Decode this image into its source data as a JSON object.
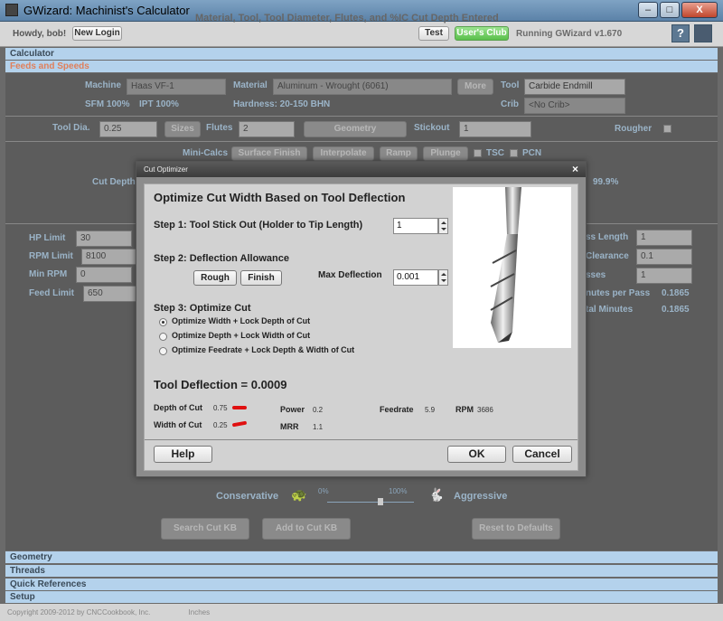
{
  "window": {
    "title": "GWizard: Machinist's Calculator",
    "buttons": [
      "–",
      "□",
      "X"
    ]
  },
  "topbar": {
    "greeting": "Howdy, bob!",
    "new_login": "New Login",
    "test": "Test",
    "users_club": "User's Club",
    "status": "Running GWizard v1.670",
    "help": "?"
  },
  "sections": {
    "calculator": "Calculator",
    "feeds_speeds": "Feeds and Speeds",
    "geometry": "Geometry",
    "threads": "Threads",
    "quick_references": "Quick References",
    "setup": "Setup"
  },
  "bg_title": "Material, Tool, Tool Diameter, Flutes, and %IC Cut Depth Entered",
  "feeds": {
    "machine_label": "Machine",
    "machine_value": "Haas VF-1",
    "material_label": "Material",
    "material_value": "Aluminum - Wrought (6061)",
    "more": "More",
    "tool_label": "Tool",
    "tool_value": "Carbide Endmill",
    "sfm": "SFM 100%",
    "ipt": "IPT 100%",
    "hardness": "Hardness: 20-150 BHN",
    "crib_label": "Crib",
    "crib_value": "<No Crib>",
    "tooldia_label": "Tool Dia.",
    "tooldia_value": "0.25",
    "sizes": "Sizes",
    "flutes_label": "Flutes",
    "flutes_value": "2",
    "geometry_btn": "Geometry",
    "stickout_label": "Stickout",
    "stickout_value": "1",
    "rougher_label": "Rougher",
    "minicalcs": "Mini-Calcs",
    "surface_finish": "Surface Finish",
    "interpolate": "Interpolate",
    "ramp": "Ramp",
    "plunge": "Plunge",
    "tsc": "TSC",
    "pcn": "PCN",
    "cut_depth": "Cut Depth",
    "pct": "99.9%",
    "hp_limit_label": "HP Limit",
    "hp_limit": "30",
    "rpm_limit_label": "RPM Limit",
    "rpm_limit": "8100",
    "min_rpm_label": "Min RPM",
    "min_rpm": "0",
    "feed_limit_label": "Feed Limit",
    "feed_limit": "650",
    "pass_length_label": "ss Length",
    "pass_length": "1",
    "clearance_label": "Clearance",
    "clearance": "0.1",
    "passes_label": "sses",
    "passes": "1",
    "min_per_pass_label": "nutes per Pass",
    "min_per_pass": "0.1865",
    "total_min_label": "tal Minutes",
    "total_min": "0.1865",
    "conservative": "Conservative",
    "aggressive": "Aggressive",
    "pct0": "0%",
    "pct100": "100%",
    "search_cut_kb": "Search Cut KB",
    "add_cut_kb": "Add to Cut KB",
    "reset_defaults": "Reset to Defaults"
  },
  "dialog": {
    "title": "Cut Optimizer",
    "close": "×",
    "heading": "Optimize Cut Width Based on Tool Deflection",
    "step1": "Step 1: Tool Stick Out (Holder to Tip Length)",
    "step1_value": "1",
    "step2": "Step 2: Deflection Allowance",
    "rough": "Rough",
    "finish": "Finish",
    "max_deflection_label": "Max Deflection",
    "max_deflection": "0.001",
    "step3": "Step 3: Optimize Cut",
    "options": [
      "Optimize Width + Lock Depth of Cut",
      "Optimize Depth + Lock Width of Cut",
      "Optimize Feedrate + Lock Depth & Width of Cut"
    ],
    "deflection": "Tool Deflection = 0.0009",
    "depth_label": "Depth of Cut",
    "depth_value": "0.75",
    "width_label": "Width of Cut",
    "width_value": "0.25",
    "power_label": "Power",
    "power_value": "0.2",
    "mrr_label": "MRR",
    "mrr_value": "1.1",
    "feedrate_label": "Feedrate",
    "feedrate_value": "5.9",
    "rpm_label": "RPM",
    "rpm_value": "3686",
    "help": "Help",
    "ok": "OK",
    "cancel": "Cancel"
  },
  "status": {
    "copyright": "Copyright 2009-2012 by CNCCookbook, Inc.",
    "units": "Inches"
  }
}
